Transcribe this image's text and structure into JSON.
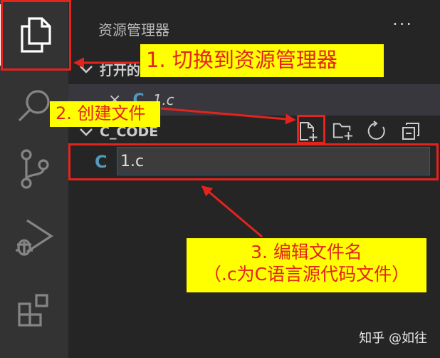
{
  "explorer": {
    "title": "资源管理器",
    "more": "···",
    "open_editors_label": "打开的",
    "open_file": {
      "close": "×",
      "lang": "C",
      "name": "1.c"
    },
    "workspace_label": "C_CODE",
    "new_file": {
      "lang": "C",
      "value": "1.c"
    }
  },
  "annotations": {
    "step1": "1. 切换到资源管理器",
    "step2": "2. 创建文件",
    "step3_line1": "3. 编辑文件名",
    "step3_line2": "（.c为C语言源代码文件）"
  },
  "watermark": "知乎 @如往",
  "colors": {
    "annotation_red": "#e4231d",
    "annotation_yellow": "#ffff00",
    "c_icon": "#519aba"
  },
  "icons": [
    "explorer-files-icon",
    "search-icon",
    "source-control-icon",
    "run-debug-icon",
    "extensions-icon",
    "new-file-icon",
    "new-folder-icon",
    "refresh-icon",
    "collapse-all-icon",
    "chevron-down-icon"
  ]
}
